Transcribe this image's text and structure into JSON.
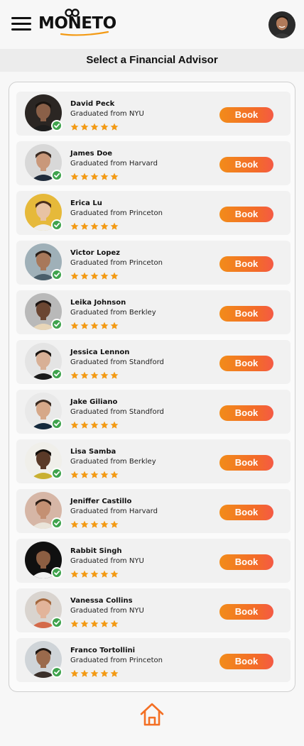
{
  "app": {
    "logo_text": "MONETO",
    "page_title": "Select a Financial Advisor"
  },
  "colors": {
    "accent": "#f36f24",
    "verified": "#3fa34d",
    "star": "#f39a14"
  },
  "icons": {
    "menu": "hamburger-menu-icon",
    "verified": "check-badge-icon",
    "star": "star-icon",
    "home": "home-icon"
  },
  "book_label": "Book",
  "advisors": [
    {
      "name": "David Peck",
      "school": "Graduated from NYU",
      "rating": 5,
      "avatar_bg": "#2b2623",
      "skin": "#8a6048",
      "hair": "#1a1410",
      "shirt": "#1d1d1d"
    },
    {
      "name": "James Doe",
      "school": "Graduated from Harvard",
      "rating": 5,
      "avatar_bg": "#d8d8d8",
      "skin": "#c9987a",
      "hair": "#3b2b22",
      "shirt": "#1f2a3a"
    },
    {
      "name": "Erica Lu",
      "school": "Graduated from Princeton",
      "rating": 5,
      "avatar_bg": "#e6b93a",
      "skin": "#e8c3a4",
      "hair": "#4a2e1c",
      "shirt": "#f0eeea"
    },
    {
      "name": "Victor Lopez",
      "school": "Graduated from Princeton",
      "rating": 5,
      "avatar_bg": "#9fb0b8",
      "skin": "#a8785a",
      "hair": "#2a1e17",
      "shirt": "#4a5e6a"
    },
    {
      "name": "Leika Johnson",
      "school": "Graduated from Berkley",
      "rating": 5,
      "avatar_bg": "#b9b9b9",
      "skin": "#6b4632",
      "hair": "#1d1512",
      "shirt": "#e8d6b8"
    },
    {
      "name": "Jessica Lennon",
      "school": "Graduated from Standford",
      "rating": 5,
      "avatar_bg": "#e4e4e4",
      "skin": "#d8b096",
      "hair": "#1b1511",
      "shirt": "#1a1a1a"
    },
    {
      "name": "Jake Giliano",
      "school": "Graduated from Standford",
      "rating": 5,
      "avatar_bg": "#e9e9e9",
      "skin": "#d6a889",
      "hair": "#3a2a20",
      "shirt": "#152a3d"
    },
    {
      "name": "Lisa Samba",
      "school": "Graduated from Berkley",
      "rating": 5,
      "avatar_bg": "#f0efea",
      "skin": "#5a3a28",
      "hair": "#14100c",
      "shirt": "#c9b032"
    },
    {
      "name": "Jeniffer Castillo",
      "school": "Graduated from Harvard",
      "rating": 5,
      "avatar_bg": "#d6b6a6",
      "skin": "#c49073",
      "hair": "#2e1f17",
      "shirt": "#eae4da"
    },
    {
      "name": "Rabbit Singh",
      "school": "Graduated from NYU",
      "rating": 5,
      "avatar_bg": "#101010",
      "skin": "#8c5e42",
      "hair": "#151010",
      "shirt": "#f2f2f2"
    },
    {
      "name": "Vanessa Collins",
      "school": "Graduated from NYU",
      "rating": 5,
      "avatar_bg": "#d9d4cf",
      "skin": "#e2b49a",
      "hair": "#a4683e",
      "shirt": "#d46a4a"
    },
    {
      "name": "Franco Tortollini",
      "school": "Graduated from Princeton",
      "rating": 5,
      "avatar_bg": "#cfd4d8",
      "skin": "#9a6a4c",
      "hair": "#1f1712",
      "shirt": "#3a2f2a"
    }
  ]
}
